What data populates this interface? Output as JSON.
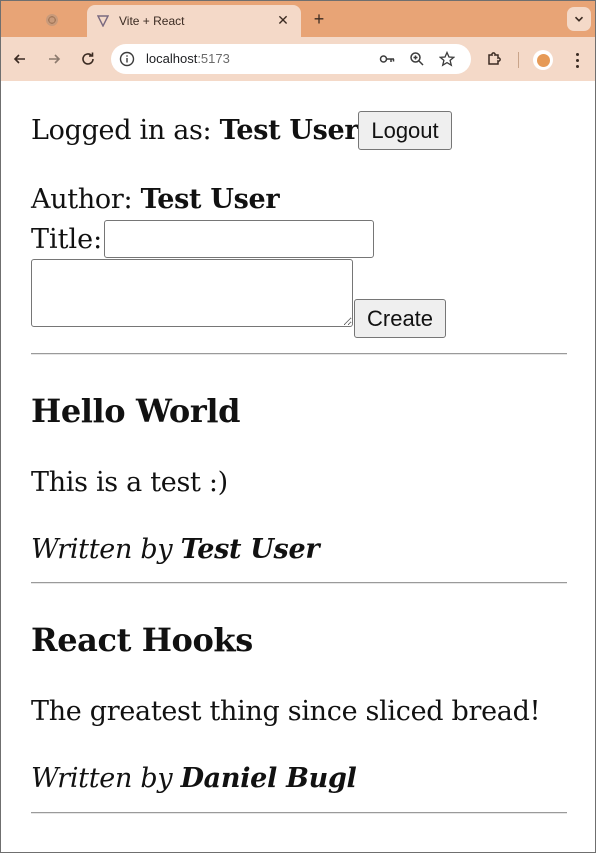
{
  "browser": {
    "active_tab": {
      "title": "Vite + React"
    },
    "url": {
      "host": "localhost",
      "port": ":5173"
    }
  },
  "user_bar": {
    "prefix": "Logged in as: ",
    "username": "Test User",
    "logout_label": "Logout"
  },
  "create_form": {
    "author_prefix": "Author: ",
    "author_name": "Test User",
    "title_label": "Title:",
    "title_value": "",
    "content_value": "",
    "create_label": "Create"
  },
  "posts": [
    {
      "title": "Hello World",
      "contents": "This is a test :)",
      "byline_prefix": "Written by ",
      "author": "Test User"
    },
    {
      "title": "React Hooks",
      "contents": "The greatest thing since sliced bread!",
      "byline_prefix": "Written by ",
      "author": "Daniel Bugl"
    }
  ],
  "icons": {
    "inactive_tab": "globe-icon",
    "active_tab": "vite-logo-icon",
    "close": "close-icon",
    "new_tab": "plus-icon",
    "tab_search": "chevron-down-icon",
    "back": "arrow-left-icon",
    "forward": "arrow-right-icon",
    "reload": "reload-icon",
    "site_info": "info-icon",
    "password": "key-icon",
    "zoom": "zoom-icon",
    "bookmark": "star-icon",
    "extensions": "puzzle-icon",
    "profile": "avatar",
    "menu": "kebab-menu-icon"
  },
  "colors": {
    "tab_strip": "#e8a476",
    "toolbar": "#f4d9c8"
  }
}
